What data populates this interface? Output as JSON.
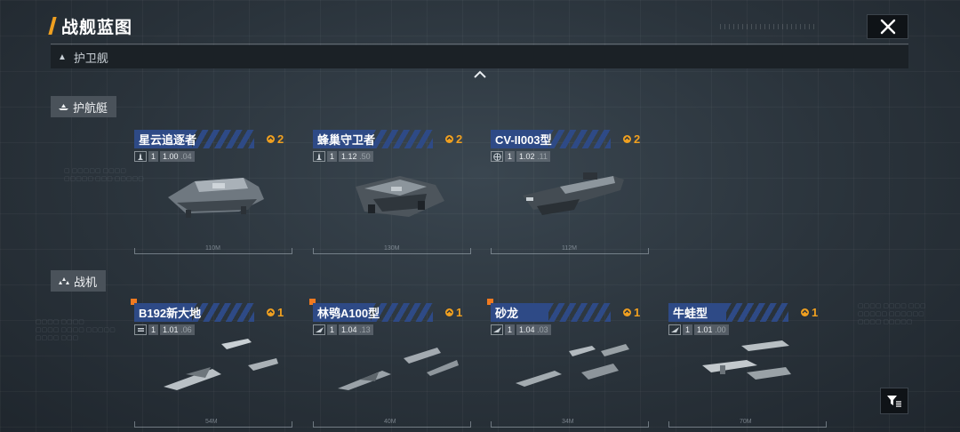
{
  "header": {
    "title": "战舰蓝图",
    "close_icon": "close-icon"
  },
  "filter": {
    "label": "护卫舰",
    "icon": "triangle-up-icon"
  },
  "categories": [
    {
      "label": "护航艇",
      "icon": "escort-boat-icon",
      "cards": [
        {
          "name": "星云追逐者",
          "badge": "2",
          "stat_icon": "missile-icon",
          "level": "1",
          "stat_main": "1.00",
          "stat_sub": ".04",
          "ruler": "110M",
          "flag": false
        },
        {
          "name": "蜂巢守卫者",
          "badge": "2",
          "stat_icon": "missile-icon",
          "level": "1",
          "stat_main": "1.12",
          "stat_sub": ".50",
          "ruler": "130M",
          "flag": false
        },
        {
          "name": "CV-II003型",
          "badge": "2",
          "stat_icon": "globe-icon",
          "level": "1",
          "stat_main": "1.02",
          "stat_sub": ".11",
          "ruler": "112M",
          "flag": false
        }
      ]
    },
    {
      "label": "战机",
      "icon": "fighter-squad-icon",
      "cards": [
        {
          "name": "B192新大地",
          "badge": "1",
          "stat_icon": "bomber-icon",
          "level": "1",
          "stat_main": "1.01",
          "stat_sub": ".06",
          "ruler": "54M",
          "flag": true
        },
        {
          "name": "林鸮A100型",
          "badge": "1",
          "stat_icon": "fighter-icon",
          "level": "1",
          "stat_main": "1.04",
          "stat_sub": ".13",
          "ruler": "40M",
          "flag": true
        },
        {
          "name": "砂龙",
          "badge": "1",
          "stat_icon": "fighter-icon",
          "level": "1",
          "stat_main": "1.04",
          "stat_sub": ".03",
          "ruler": "34M",
          "flag": true
        },
        {
          "name": "牛蛙型",
          "badge": "1",
          "stat_icon": "fighter-icon",
          "level": "1",
          "stat_main": "1.01",
          "stat_sub": ".00",
          "ruler": "70M",
          "flag": false
        }
      ]
    }
  ],
  "side_button_icon": "filter-sort-icon",
  "colors": {
    "accent": "#f0a020",
    "card_header": "#2e4a86",
    "flag": "#f07a20"
  }
}
